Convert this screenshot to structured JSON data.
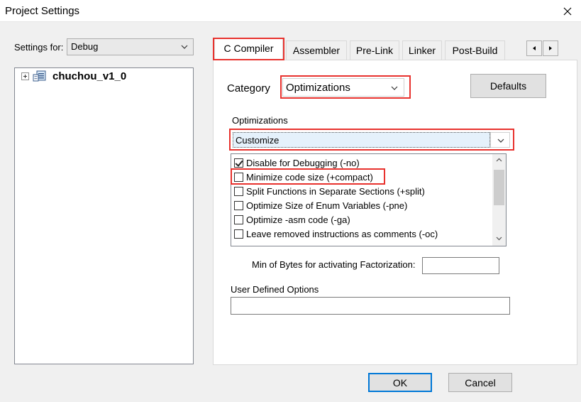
{
  "window": {
    "title": "Project Settings"
  },
  "left": {
    "settings_for_label": "Settings for:",
    "settings_for_value": "Debug",
    "tree_root": "chuchou_v1_0"
  },
  "tabs": [
    {
      "label": "C Compiler",
      "active": true
    },
    {
      "label": "Assembler",
      "active": false
    },
    {
      "label": "Pre-Link",
      "active": false
    },
    {
      "label": "Linker",
      "active": false
    },
    {
      "label": "Post-Build",
      "active": false
    }
  ],
  "compiler": {
    "category_label": "Category",
    "category_value": "Optimizations",
    "defaults_label": "Defaults",
    "optimizations_label": "Optimizations",
    "optimizations_value": "Customize",
    "options": [
      {
        "label": "Disable for Debugging (-no)",
        "checked": true
      },
      {
        "label": "Minimize code size (+compact)",
        "checked": false
      },
      {
        "label": "Split Functions in Separate Sections (+split)",
        "checked": false
      },
      {
        "label": "Optimize Size of Enum Variables (-pne)",
        "checked": false
      },
      {
        "label": "Optimize -asm code (-ga)",
        "checked": false
      },
      {
        "label": "Leave removed instructions as comments (-oc)",
        "checked": false
      }
    ],
    "min_bytes_label": "Min of Bytes for activating Factorization:",
    "min_bytes_value": "",
    "user_defined_label": "User Defined Options",
    "user_defined_value": ""
  },
  "buttons": {
    "ok": "OK",
    "cancel": "Cancel"
  },
  "colors": {
    "highlight": "#e8322e",
    "focus": "#0078d7"
  }
}
